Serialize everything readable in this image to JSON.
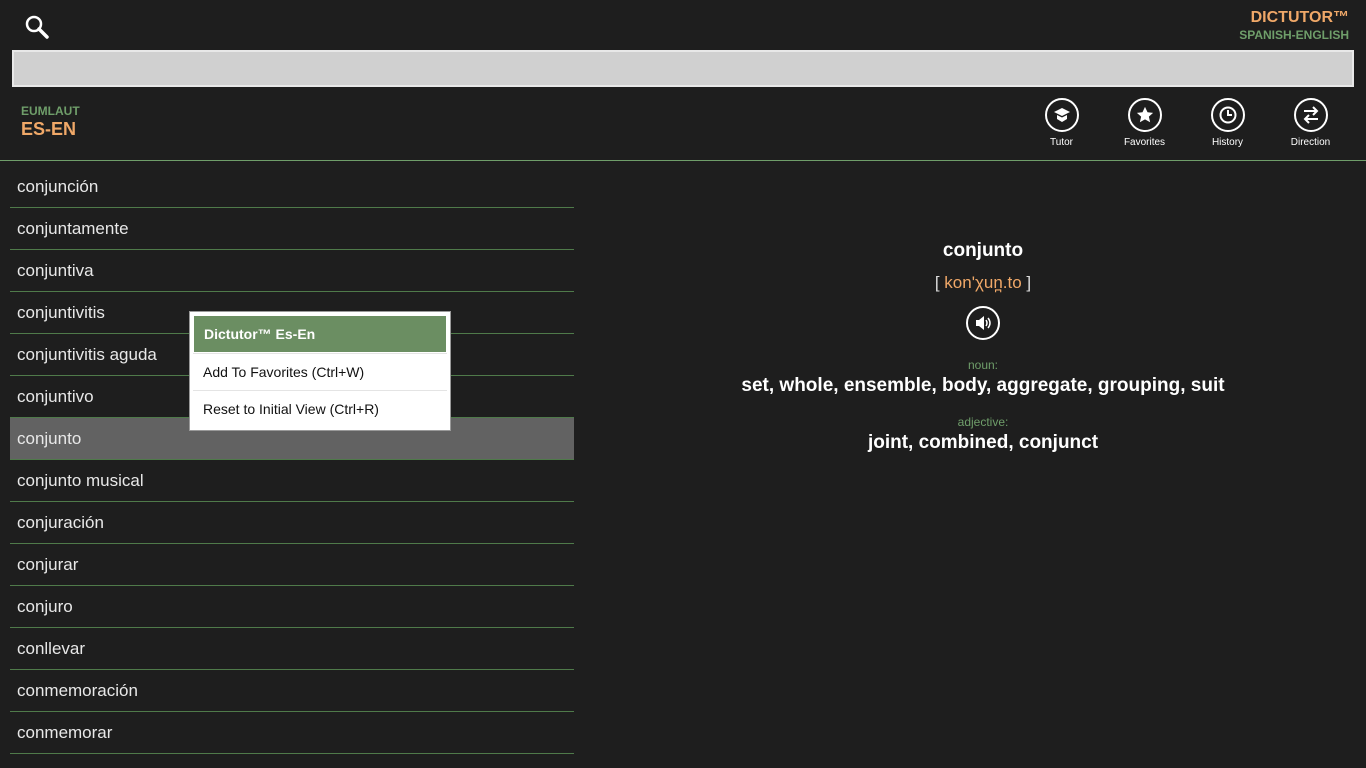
{
  "header": {
    "app_title": "DICTUTOR™",
    "app_subtitle": "SPANISH-ENGLISH",
    "search_value": "",
    "publisher": "EUMLAUT",
    "pair": "ES-EN"
  },
  "toolbar": [
    {
      "label": "Tutor",
      "icon": "graduation-cap-icon"
    },
    {
      "label": "Favorites",
      "icon": "star-icon"
    },
    {
      "label": "History",
      "icon": "history-icon"
    },
    {
      "label": "Direction",
      "icon": "swap-arrows-icon"
    }
  ],
  "words": [
    "conjunción",
    "conjuntamente",
    "conjuntiva",
    "conjuntivitis",
    "conjuntivitis aguda",
    "conjuntivo",
    "conjunto",
    "conjunto musical",
    "conjuración",
    "conjurar",
    "conjuro",
    "conllevar",
    "conmemoración",
    "conmemorar"
  ],
  "selected_index": 6,
  "entry": {
    "word": "conjunto",
    "pron_open": "[",
    "pronunciation": "kon'χun̪.to",
    "pron_close": "]",
    "senses": [
      {
        "pos": "noun:",
        "translations": "set, whole, ensemble, body, aggregate, grouping, suit"
      },
      {
        "pos": "adjective:",
        "translations": "joint, combined, conjunct"
      }
    ]
  },
  "context_menu": {
    "header": "Dictutor™ Es-En",
    "items": [
      "Add To Favorites (Ctrl+W)",
      "Reset to Initial View (Ctrl+R)"
    ]
  }
}
